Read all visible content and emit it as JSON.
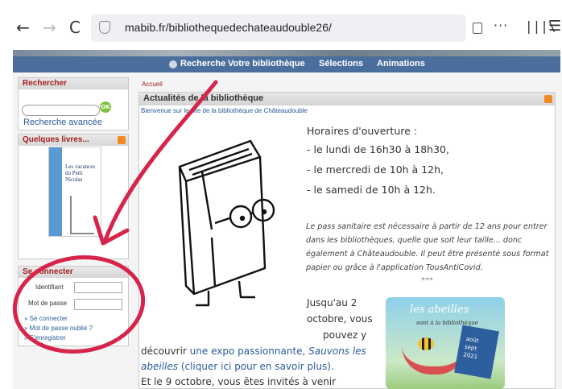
{
  "browser": {
    "url": "mabib.fr/bibliothequedechateaudouble26/",
    "icons": [
      "back-arrow-icon",
      "forward-arrow-icon",
      "reload-icon",
      "shield-icon",
      "reader-view-icon",
      "more-icon",
      "library-icon",
      "menu-icon"
    ],
    "back_glyph": "←",
    "forward_glyph": "→",
    "reload_glyph": "C",
    "more_glyph": "···",
    "library_glyph": "|||\\",
    "menu_glyph": "☰"
  },
  "site_nav": {
    "items": [
      "Recherche",
      "Votre bibliothèque",
      "Sélections",
      "Animations"
    ]
  },
  "sidebar": {
    "search": {
      "title": "Rechercher",
      "ok_label": "OK",
      "advanced_link": "Recherche avancée"
    },
    "books": {
      "title": "Quelques livres...",
      "cover_text": "Les vacances du Petit Nicolas"
    },
    "login": {
      "title": "Se connecter",
      "id_label": "Identifiant",
      "password_label": "Mot de passe",
      "links": [
        "» Se connecter",
        "» Mot de passe oublié ?",
        "» S'enregistrer"
      ]
    }
  },
  "main": {
    "breadcrumb": "Accueil",
    "title": "Actualités de la bibliothèque",
    "welcome": "Bienvenue sur le site de la bibliothèque de Châteaudouble",
    "hours": [
      "Horaires d'ouverture :",
      "- le lundi de 16h30 à 18h30,",
      "- le mercredi de 10h à 12h,",
      "- le samedi de 10h à 12h."
    ],
    "notice": "Le pass sanitaire est nécessaire à partir de 12 ans pour entrer dans les bibliothèques, quelle que soit leur taille... donc également à Châteaudouble. Il peut être présenté sous format papier ou grâce à l'application TousAntiCovid.",
    "separator": "***",
    "expo_lines": [
      "Jusqu'au 2",
      "octobre, vous",
      "pouvez y"
    ],
    "expo_text_1": "découvrir ",
    "expo_link": "une expo passionnante, ",
    "expo_link_italic": "Sauvons les abeilles",
    "expo_link_2": " (cliquer ici pour en savoir plus).",
    "last_line": "Et le 9 octobre, vous êtes invités à venir",
    "bee_image": {
      "title": "les abeilles",
      "subtitle": "sont à la bibliothèque",
      "dates": [
        "août",
        "sept",
        "2021"
      ]
    }
  },
  "colors": {
    "nav_bg": "#4a6f9c",
    "accent_red": "#a31d1d",
    "link_blue": "#2a5d9c",
    "annotation": "#d6244a"
  }
}
